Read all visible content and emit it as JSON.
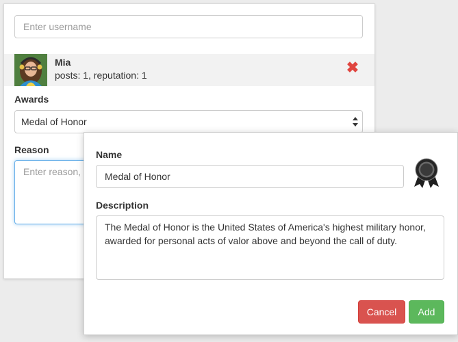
{
  "user_form": {
    "username_placeholder": "Enter username",
    "user": {
      "name": "Mia",
      "stats": "posts: 1, reputation: 1",
      "remove_icon": "close-icon"
    },
    "awards": {
      "label": "Awards",
      "selected": "Medal of Honor"
    },
    "reason": {
      "label": "Reason",
      "placeholder": "Enter reason, award"
    }
  },
  "award_editor": {
    "name_label": "Name",
    "name_value": "Medal of Honor",
    "medal_icon": "medal-icon",
    "description_label": "Description",
    "description_value": "The Medal of Honor is the United States of America's highest military honor, awarded for personal acts of valor above and beyond the call of duty.",
    "cancel_label": "Cancel",
    "add_label": "Add"
  },
  "colors": {
    "remove": "#e0453f",
    "cancel": "#d9534f",
    "add": "#5cb85c",
    "focus": "#66afe9"
  }
}
